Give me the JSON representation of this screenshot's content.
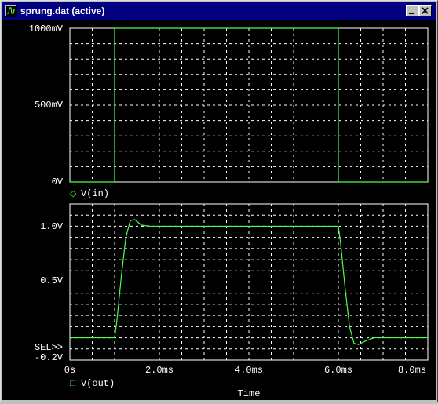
{
  "window": {
    "title": "sprung.dat (active)",
    "app_icon": "probe-waveform-icon",
    "controls": [
      "minimize-icon",
      "maximize-icon",
      "close-icon"
    ]
  },
  "colors": {
    "background": "#000000",
    "trace": "#4cff4c",
    "grid": "#ffffff",
    "titlebar": "#000080"
  },
  "plots": {
    "top": {
      "y_ticks": [
        "1000mV",
        "500mV",
        "0V"
      ],
      "legend_marker": "◇",
      "legend": "V(in)"
    },
    "bottom": {
      "y_ticks": [
        "1.0V",
        "0.5V",
        "SEL>>",
        "-0.2V"
      ],
      "legend_marker": "□",
      "legend": "V(out)"
    },
    "x_ticks": [
      "0s",
      "2.0ms",
      "4.0ms",
      "6.0ms",
      "8.0ms"
    ],
    "x_label": "Time"
  },
  "chart_data": [
    {
      "type": "line",
      "series": [
        {
          "name": "V(in)",
          "x_ms": [
            0,
            1.0,
            1.0,
            6.0,
            6.0,
            8.0
          ],
          "y_mV": [
            0,
            0,
            1000,
            1000,
            0,
            0
          ]
        }
      ],
      "xlim_ms": [
        0,
        8
      ],
      "ylim_mV": [
        0,
        1000
      ],
      "grid": true
    },
    {
      "type": "line",
      "series": [
        {
          "name": "V(out)",
          "x_ms": [
            0,
            1.0,
            1.05,
            1.15,
            1.25,
            1.35,
            1.45,
            1.6,
            1.8,
            2.0,
            6.0,
            6.05,
            6.15,
            6.25,
            6.35,
            6.45,
            6.6,
            6.8,
            7.0,
            8.0
          ],
          "y_V": [
            0,
            0,
            0.15,
            0.55,
            0.9,
            1.05,
            1.06,
            1.01,
            1.0,
            1.0,
            1.0,
            0.85,
            0.45,
            0.1,
            -0.05,
            -0.06,
            -0.03,
            0.0,
            0.0,
            0.0
          ]
        }
      ],
      "xlim_ms": [
        0,
        8
      ],
      "ylim_V": [
        -0.2,
        1.2
      ],
      "grid": true
    }
  ]
}
